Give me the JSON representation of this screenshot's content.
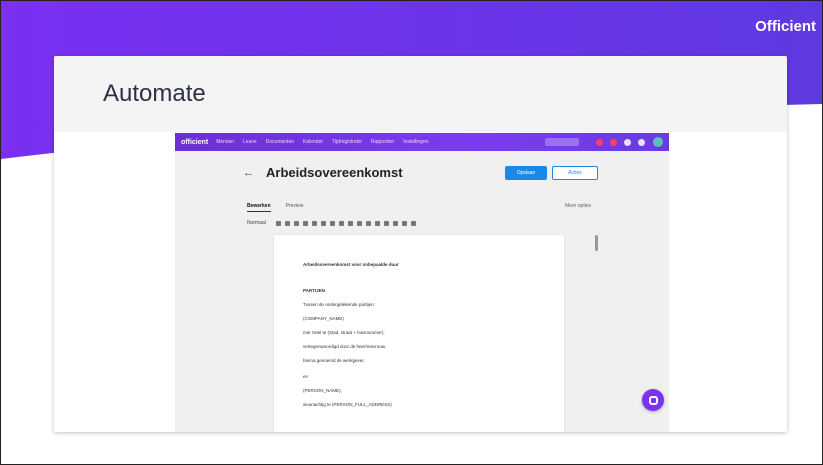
{
  "brand": {
    "name": "Officient"
  },
  "slide": {
    "title": "Automate"
  },
  "app": {
    "logo": "officient",
    "nav_items": [
      "Mensen",
      "Leave",
      "Documenten",
      "Kalender",
      "Tijdregistratie",
      "Rapporten",
      "Instellingen"
    ],
    "document": {
      "title": "Arbeidsovereenkomst",
      "back_symbol": "←",
      "primary_button": "Opslaan",
      "secondary_button": "Acties",
      "tabs": [
        "Bewerken",
        "Preview"
      ],
      "tabs_right": "Meer opties",
      "toolbar_format": "Normaal",
      "lines": [
        "Arbeidsovereenkomst voor onbepaalde duur",
        "PARTIJEN",
        "Tussen de ondergetekende partijen:",
        "(COMPANY_NAME)",
        "met zetel te (Stad, straat + huisnummer),",
        "vertegenwoordigd door de heer/mevrouw,",
        "hierna genoemd de werkgever,",
        "en",
        "(PERSON_NAME),",
        "woonachtig te (PERSON_FULL_ADDRESS)"
      ]
    }
  },
  "colors": {
    "accent": "#7c3aed",
    "primary_button": "#1e88e5",
    "hero_start": "#7a2ff2",
    "hero_end": "#5f39e0"
  }
}
